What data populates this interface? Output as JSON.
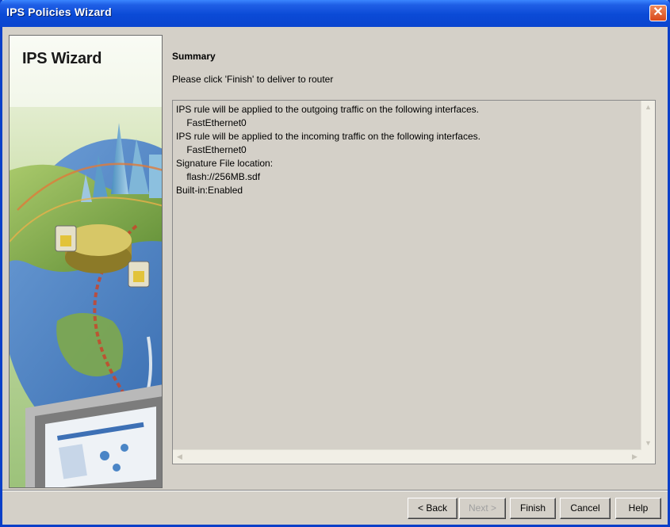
{
  "window": {
    "title": "IPS Policies Wizard",
    "close_glyph": "✕"
  },
  "left_panel": {
    "title": "IPS Wizard"
  },
  "main": {
    "heading": "Summary",
    "instruction": "Please click 'Finish' to deliver to router",
    "summary_lines": [
      "IPS rule will be applied to the outgoing traffic on the following interfaces.",
      "    FastEthernet0",
      "IPS rule will be applied to the incoming traffic on the following interfaces.",
      "    FastEthernet0",
      "Signature File location:",
      "    flash://256MB.sdf",
      "Built-in:Enabled"
    ]
  },
  "buttons": {
    "back": "< Back",
    "next": "Next >",
    "finish": "Finish",
    "cancel": "Cancel",
    "help": "Help"
  },
  "colors": {
    "title_bar": "#0b4ad6",
    "dialog_bg": "#d4d0c8",
    "close_button": "#d9491b"
  }
}
